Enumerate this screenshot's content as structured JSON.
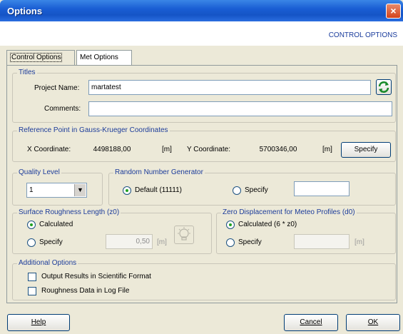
{
  "window": {
    "title": "Options",
    "close_glyph": "×"
  },
  "header": {
    "right_label": "CONTROL OPTIONS"
  },
  "tabs": [
    {
      "label": "Control Options",
      "active": true
    },
    {
      "label": "Met Options",
      "active": false
    }
  ],
  "titles": {
    "legend": "Titles",
    "project_label": "Project Name:",
    "project_value": "martatest",
    "comments_label": "Comments:",
    "comments_value": ""
  },
  "reference_point": {
    "legend": "Reference Point in Gauss-Krueger Coordinates",
    "x_label": "X Coordinate:",
    "x_value": "4498188,00",
    "x_unit": "[m]",
    "y_label": "Y Coordinate:",
    "y_value": "5700346,00",
    "y_unit": "[m]",
    "specify_button": "Specify"
  },
  "quality": {
    "legend": "Quality Level",
    "selected": "1"
  },
  "random": {
    "legend": "Random Number Generator",
    "option_default": "Default (11111)",
    "option_specify": "Specify",
    "specify_value": "",
    "selected": "default"
  },
  "roughness": {
    "legend": "Surface Roughness Length (z0)",
    "option_calculated": "Calculated",
    "option_specify": "Specify",
    "value": "0,50",
    "unit": "[m]",
    "selected": "calculated"
  },
  "displacement": {
    "legend": "Zero Displacement for Meteo Profiles (d0)",
    "option_calculated": "Calculated (6 * z0)",
    "option_specify": "Specify",
    "value": "",
    "unit": "[m]",
    "selected": "calculated"
  },
  "additional": {
    "legend": "Additional Options",
    "scientific": "Output Results in Scientific Format",
    "log_file": "Roughness Data in Log File"
  },
  "buttons": {
    "help": "Help",
    "cancel": "Cancel",
    "ok": "OK"
  },
  "icons": {
    "refresh": "refresh-icon",
    "bulb": "lightbulb-icon"
  }
}
